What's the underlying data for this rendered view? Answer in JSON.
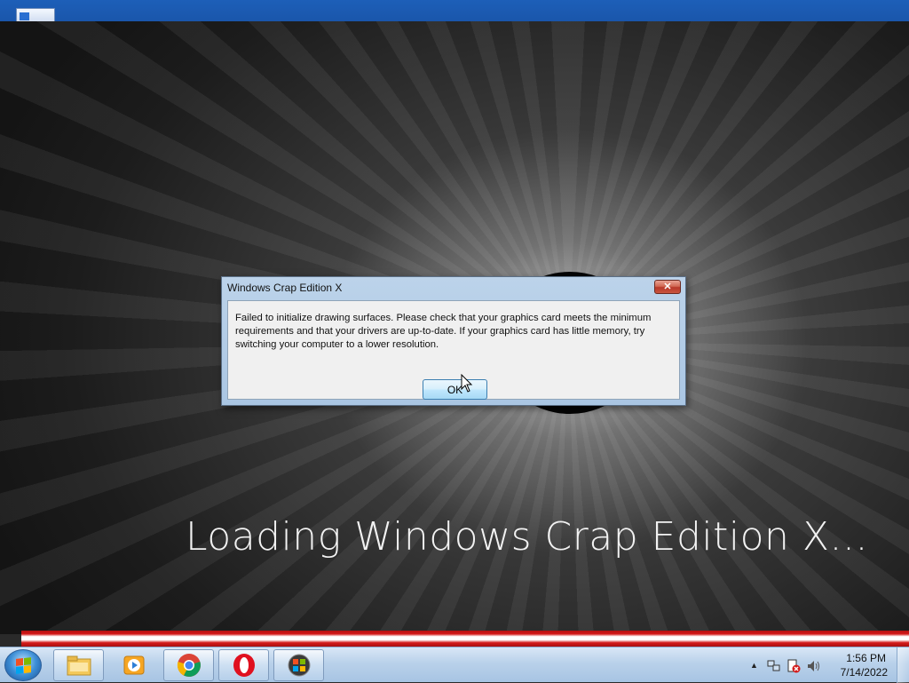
{
  "dialog": {
    "title": "Windows Crap Edition X",
    "close_glyph": "✕",
    "message": "Failed to initialize drawing surfaces. Please check that your graphics card meets the minimum requirements and that your drivers are up-to-date. If your graphics card has little memory, try switching your computer to a lower resolution.",
    "ok_label": "OK"
  },
  "loading": {
    "text": "Loading Windows Crap Edition X..."
  },
  "taskbar": {
    "pinned": [
      {
        "name": "file-explorer-icon"
      },
      {
        "name": "media-player-icon"
      },
      {
        "name": "chrome-icon"
      },
      {
        "name": "opera-icon"
      },
      {
        "name": "windows-app-icon"
      }
    ],
    "tray": {
      "chevron": "▲",
      "clock_time": "1:56 PM",
      "clock_date": "7/14/2022"
    }
  },
  "colors": {
    "progress_red": "#d41a1a",
    "taskbar_blue": "#b9d1ea",
    "desktop_blue": "#1d5fb8"
  }
}
